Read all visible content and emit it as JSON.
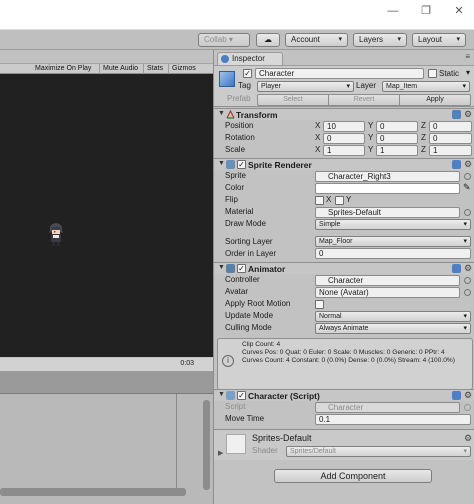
{
  "titlebar": {
    "minimize": "—",
    "restore": "❐",
    "close": "✕"
  },
  "toolbar": {
    "collab": "Collab ▾",
    "cloud": "☁",
    "account": "Account",
    "layers": "Layers",
    "layout": "Layout",
    "caret": "▾"
  },
  "game_bar": {
    "maximize_on_play": "Maximize On Play",
    "mute_audio": "Mute Audio",
    "stats": "Stats",
    "gizmos": "Gizmos"
  },
  "animation": {
    "time": "0:03"
  },
  "inspector": {
    "tab": "Inspector",
    "menu": "≡",
    "object": {
      "name": "Character",
      "static_label": "Static",
      "tag_label": "Tag",
      "tag_value": "Player",
      "layer_label": "Layer",
      "layer_value": "Map_Item",
      "prefab_label": "Prefab",
      "select": "Select",
      "revert": "Revert",
      "apply": "Apply"
    },
    "transform": {
      "title": "Transform",
      "position_label": "Position",
      "rotation_label": "Rotation",
      "scale_label": "Scale",
      "x": "X",
      "y": "Y",
      "z": "Z",
      "position": [
        "10",
        "0",
        "0"
      ],
      "rotation": [
        "0",
        "0",
        "0"
      ],
      "scale": [
        "1",
        "1",
        "1"
      ]
    },
    "sprite_renderer": {
      "title": "Sprite Renderer",
      "sprite_label": "Sprite",
      "sprite_value": "Character_Right3",
      "color_label": "Color",
      "flip_label": "Flip",
      "flip_x": "X",
      "flip_y": "Y",
      "material_label": "Material",
      "material_value": "Sprites-Default",
      "draw_mode_label": "Draw Mode",
      "draw_mode_value": "Simple",
      "sorting_layer_label": "Sorting Layer",
      "sorting_layer_value": "Map_Floor",
      "order_label": "Order in Layer",
      "order_value": "0"
    },
    "animator": {
      "title": "Animator",
      "controller_label": "Controller",
      "controller_value": "Character",
      "avatar_label": "Avatar",
      "avatar_value": "None (Avatar)",
      "root_motion_label": "Apply Root Motion",
      "update_mode_label": "Update Mode",
      "update_mode_value": "Normal",
      "culling_mode_label": "Culling Mode",
      "culling_mode_value": "Always Animate",
      "info": "Clip Count: 4\nCurves Pos: 0 Quat: 0 Euler: 0 Scale: 0 Muscles: 0 Generic: 0 PPtr: 4\nCurves Count: 4 Constant: 0 (0.0%) Dense: 0 (0.0%) Stream: 4 (100.0%)"
    },
    "script": {
      "title": "Character (Script)",
      "script_label": "Script",
      "script_value": "Character",
      "move_time_label": "Move Time",
      "move_time_value": "0.1"
    },
    "material": {
      "name": "Sprites-Default",
      "shader_label": "Shader",
      "shader_value": "Sprites/Default"
    },
    "add_component": "Add Component"
  },
  "colors": {
    "component_blue": "#4f81bd",
    "game_bg": "#212121",
    "panel_bg": "#c2c2c2"
  }
}
